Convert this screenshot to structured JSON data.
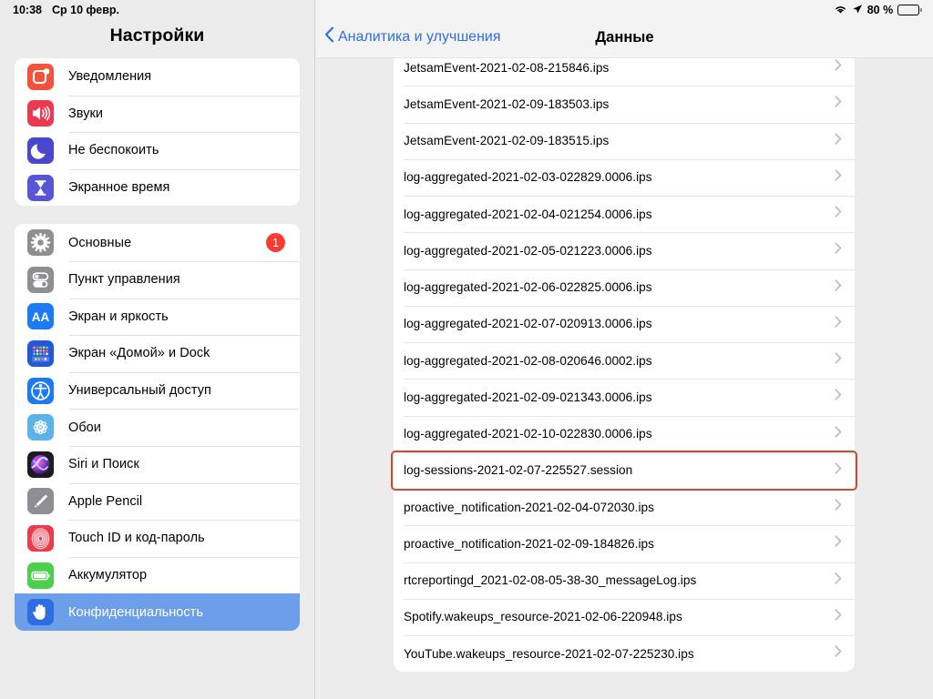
{
  "status_bar": {
    "time": "10:38",
    "date": "Ср 10 февр.",
    "battery_percent": "80 %",
    "wifi_icon": "wifi-icon",
    "location_icon": "location-arrow-icon",
    "battery_icon": "battery-icon",
    "battery_level": 80
  },
  "sidebar": {
    "title": "Настройки",
    "groups": [
      {
        "items": [
          {
            "label": "Уведомления",
            "icon": "notifications-icon",
            "color": "#f4523c",
            "badge": null
          },
          {
            "label": "Звуки",
            "icon": "sounds-icon",
            "color": "#ea3a52",
            "badge": null
          },
          {
            "label": "Не беспокоить",
            "icon": "moon-icon",
            "color": "#4a47cf",
            "badge": null
          },
          {
            "label": "Экранное время",
            "icon": "hourglass-icon",
            "color": "#5856d6",
            "badge": null
          }
        ]
      },
      {
        "items": [
          {
            "label": "Основные",
            "icon": "gear-icon",
            "color": "#8e8e93",
            "badge": "1"
          },
          {
            "label": "Пункт управления",
            "icon": "toggles-icon",
            "color": "#8e8e93",
            "badge": null
          },
          {
            "label": "Экран и яркость",
            "icon": "aa-text-icon",
            "color": "#1c7bf2",
            "badge": null
          },
          {
            "label": "Экран «Домой» и Dock",
            "icon": "home-dock-icon",
            "color": "#2159d8",
            "badge": null
          },
          {
            "label": "Универсальный доступ",
            "icon": "accessibility-icon",
            "color": "#1c7bf2",
            "badge": null
          },
          {
            "label": "Обои",
            "icon": "wallpaper-icon",
            "color": "#5ab4ea",
            "badge": null
          },
          {
            "label": "Siri и Поиск",
            "icon": "siri-icon",
            "color": "#1c1c1e",
            "badge": null
          },
          {
            "label": "Apple Pencil",
            "icon": "pencil-icon",
            "color": "#8e8e93",
            "badge": null
          },
          {
            "label": "Touch ID и код-пароль",
            "icon": "fingerprint-icon",
            "color": "#ec3b4e",
            "badge": null
          },
          {
            "label": "Аккумулятор",
            "icon": "battery-green-icon",
            "color": "#4cd04c",
            "badge": null
          },
          {
            "label": "Конфиденциальность",
            "icon": "hand-icon",
            "color": "#2f6ee0",
            "badge": null,
            "selected": true
          }
        ]
      }
    ]
  },
  "detail": {
    "back_label": "Аналитика и улучшения",
    "back_icon": "chevron-left-icon",
    "title": "Данные",
    "disclosure_icon": "chevron-right-icon",
    "highlighted_index": 11,
    "files": [
      "JetsamEvent-2021-02-08-215846.ips",
      "JetsamEvent-2021-02-09-183503.ips",
      "JetsamEvent-2021-02-09-183515.ips",
      "log-aggregated-2021-02-03-022829.0006.ips",
      "log-aggregated-2021-02-04-021254.0006.ips",
      "log-aggregated-2021-02-05-021223.0006.ips",
      "log-aggregated-2021-02-06-022825.0006.ips",
      "log-aggregated-2021-02-07-020913.0006.ips",
      "log-aggregated-2021-02-08-020646.0002.ips",
      "log-aggregated-2021-02-09-021343.0006.ips",
      "log-aggregated-2021-02-10-022830.0006.ips",
      "log-sessions-2021-02-07-225527.session",
      "proactive_notification-2021-02-04-072030.ips",
      "proactive_notification-2021-02-09-184826.ips",
      "rtcreportingd_2021-02-08-05-38-30_messageLog.ips",
      "Spotify.wakeups_resource-2021-02-06-220948.ips",
      "YouTube.wakeups_resource-2021-02-07-225230.ips"
    ]
  },
  "colors": {
    "accent_blue": "#2f6ee0",
    "selection_blue": "#6c9eea",
    "highlight_red": "#cc4a33",
    "badge_red": "#fa3b2f",
    "page_background": "#ececed",
    "card_background": "#ffffff"
  }
}
